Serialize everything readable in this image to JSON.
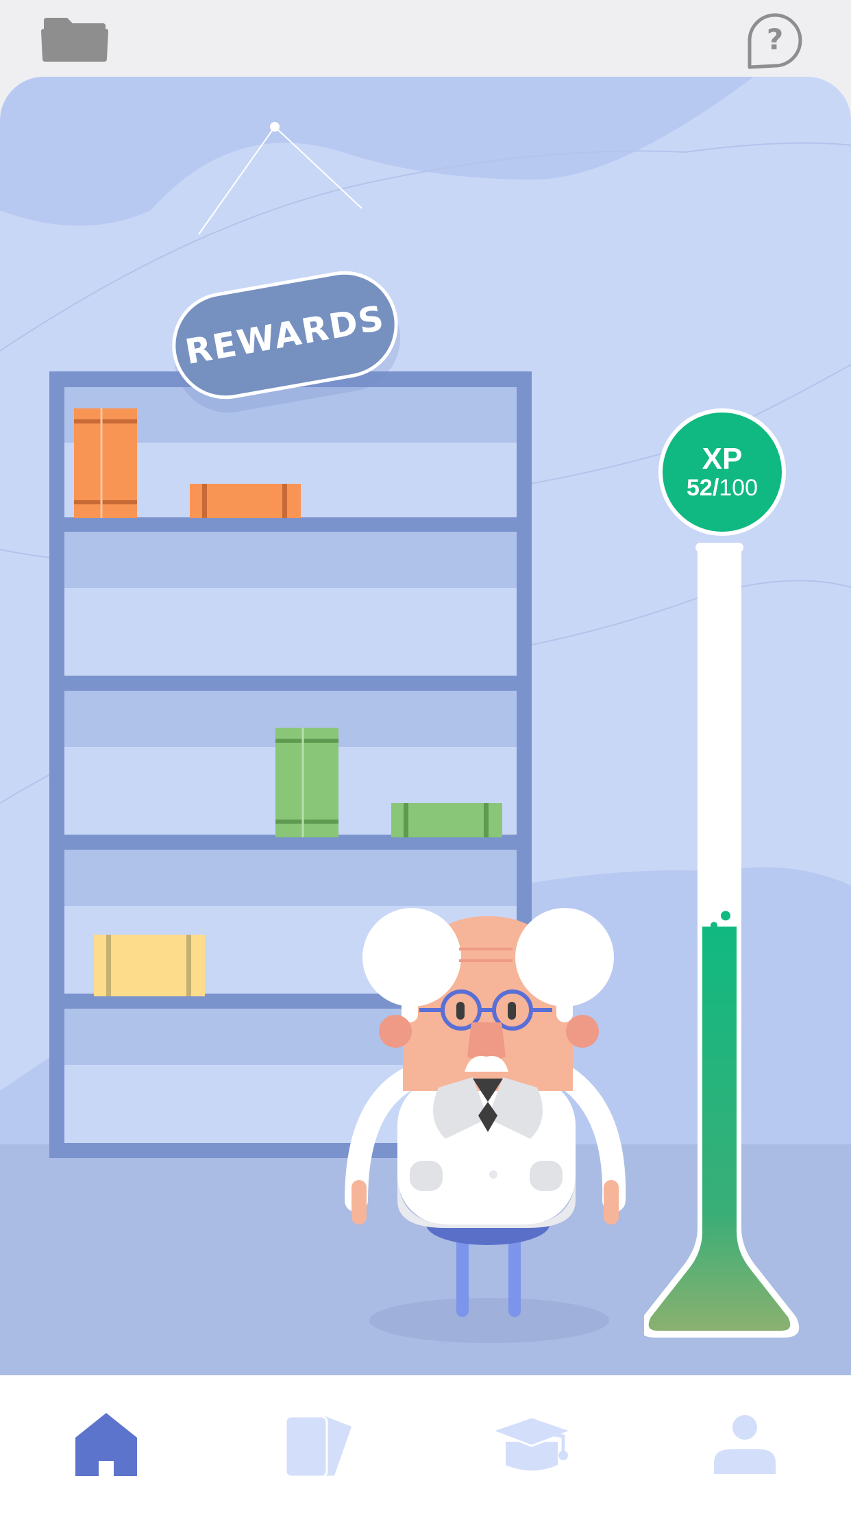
{
  "header": {
    "folder_icon": "folder-icon",
    "help_icon": "help-question-icon"
  },
  "scene": {
    "sign_text": "REWARDS",
    "bookcase": {
      "shelves": 5,
      "books": [
        {
          "shelf": 1,
          "color": "#f89554",
          "kind": "standing"
        },
        {
          "shelf": 1,
          "color": "#f89554",
          "kind": "lying"
        },
        {
          "shelf": 3,
          "color": "#89c677",
          "kind": "standing"
        },
        {
          "shelf": 3,
          "color": "#89c677",
          "kind": "lying"
        },
        {
          "shelf": 4,
          "color": "#fddc8c",
          "kind": "lying"
        }
      ]
    },
    "character": "professor-character"
  },
  "xp": {
    "label": "XP",
    "current": "52/",
    "max": "100",
    "progress": 0.52,
    "color": "#10b981"
  },
  "nav": {
    "items": [
      {
        "name": "home",
        "icon": "home-icon",
        "active": true
      },
      {
        "name": "cards",
        "icon": "cards-icon",
        "active": false
      },
      {
        "name": "learn",
        "icon": "graduation-cap-icon",
        "active": false
      },
      {
        "name": "profile",
        "icon": "profile-icon",
        "active": false
      }
    ],
    "active_color": "#5d74cc",
    "inactive_color": "#d3defa"
  }
}
